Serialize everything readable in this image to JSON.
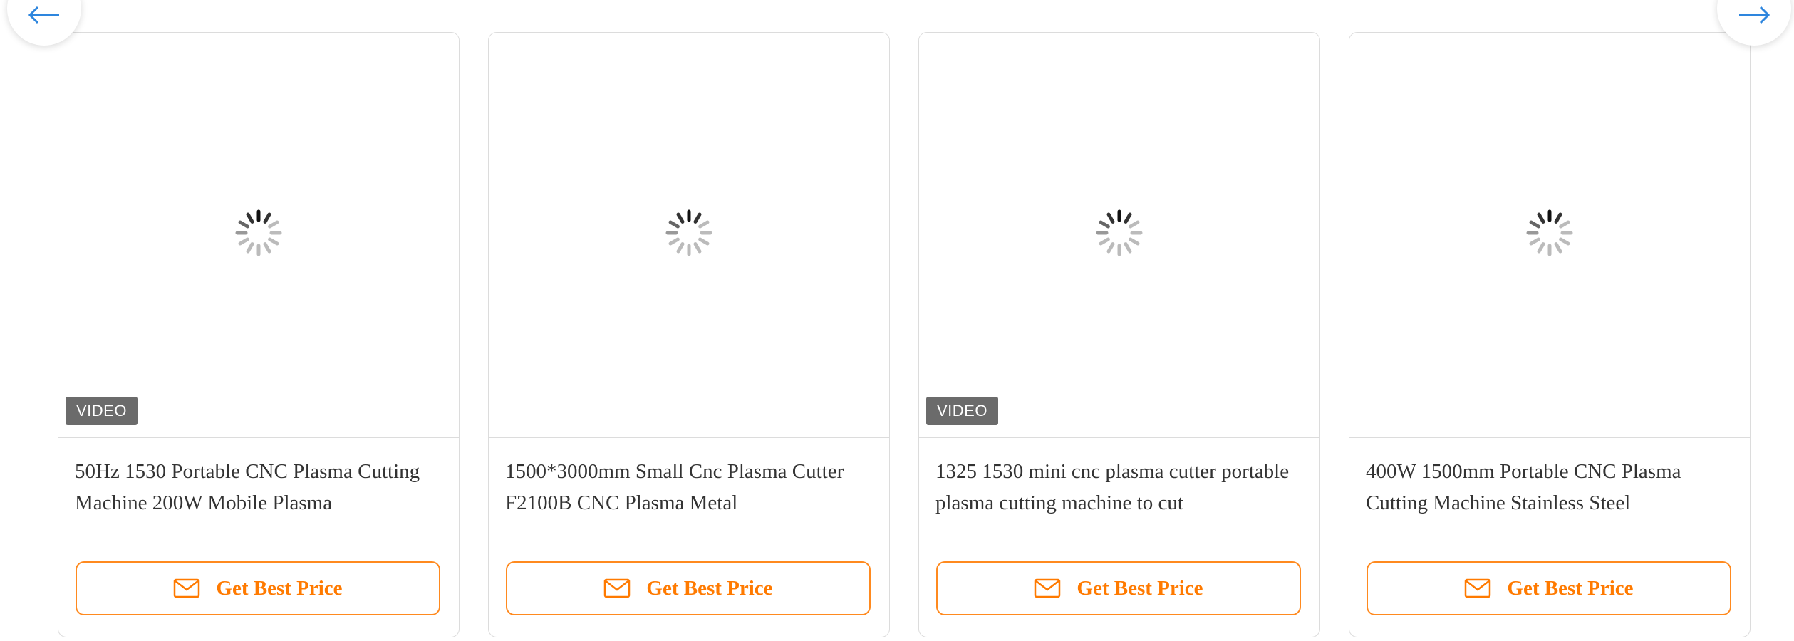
{
  "navigation": {
    "prev_icon": "arrow-left-icon",
    "next_icon": "arrow-right-icon",
    "arrow_color": "#2e86de"
  },
  "colors": {
    "accent": "#ff7a00",
    "card_border": "#dcdcdc",
    "badge_bg": "#6b6b6b"
  },
  "products": [
    {
      "badge": "VIDEO",
      "title": "50Hz 1530 Portable CNC Plasma Cutting Machine 200W Mobile Plasma",
      "button_label": "Get Best Price",
      "button_icon": "mail-icon"
    },
    {
      "badge": "",
      "title": "1500*3000mm Small Cnc Plasma Cutter F2100B CNC Plasma Metal",
      "button_label": "Get Best Price",
      "button_icon": "mail-icon"
    },
    {
      "badge": "VIDEO",
      "title": "1325 1530 mini cnc plasma cutter portable plasma cutting machine to cut",
      "button_label": "Get Best Price",
      "button_icon": "mail-icon"
    },
    {
      "badge": "",
      "title": "400W 1500mm Portable CNC Plasma Cutting Machine Stainless Steel",
      "button_label": "Get Best Price",
      "button_icon": "mail-icon"
    }
  ]
}
